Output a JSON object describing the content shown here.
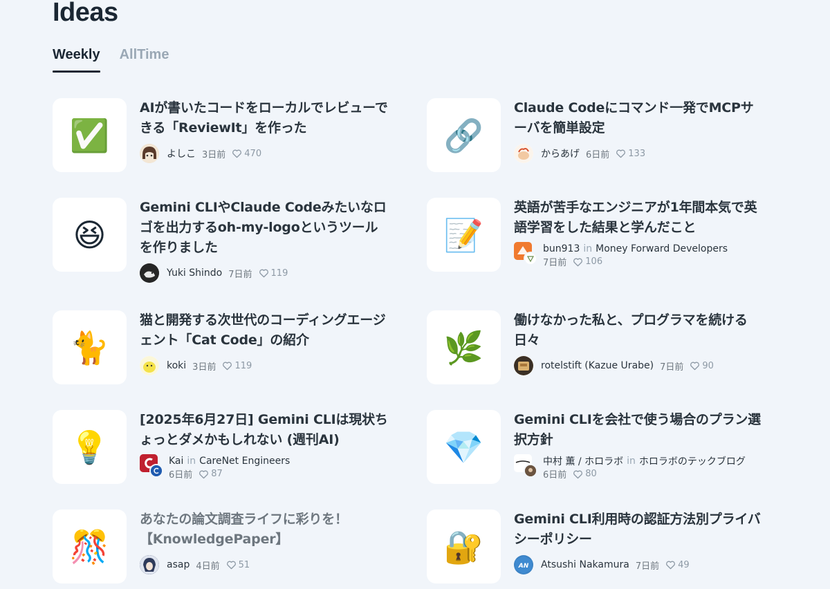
{
  "page": {
    "title": "Ideas"
  },
  "tabs": [
    {
      "label": "Weekly",
      "active": true
    },
    {
      "label": "AllTime",
      "active": false
    }
  ],
  "articles": [
    {
      "emoji": "✅",
      "emoji_name": "check-mark-icon",
      "title": "AIが書いたコードをローカルでレビューできる「ReviewIt」を作った",
      "author": "よしこ",
      "date": "3日前",
      "likes": "470"
    },
    {
      "emoji": "🔗",
      "emoji_name": "link-icon",
      "title": "Claude Codeにコマンド一発でMCPサーバを簡単設定",
      "author": "からあげ",
      "date": "6日前",
      "likes": "133"
    },
    {
      "emoji": "😆",
      "emoji_name": "laughing-face-icon",
      "title": "Gemini CLIやClaude Codeみたいなロゴを出力するoh-my-logoというツールを作りました",
      "author": "Yuki Shindo",
      "date": "7日前",
      "likes": "119"
    },
    {
      "emoji": "📝",
      "emoji_name": "memo-icon",
      "title": "英語が苦手なエンジニアが1年間本気で英語学習をした結果と学んだこと",
      "author": "bun913",
      "publication": "Money Forward Developers",
      "in_label": "in",
      "date": "7日前",
      "likes": "106"
    },
    {
      "emoji": "🐈",
      "emoji_name": "cat-icon",
      "title": "猫と開発する次世代のコーディングエージェント「Cat Code」の紹介",
      "author": "koki",
      "date": "3日前",
      "likes": "119"
    },
    {
      "emoji": "🌿",
      "emoji_name": "herb-icon",
      "title": "働けなかった私と、プログラマを続ける日々",
      "author": "rotelstift (Kazue Urabe)",
      "date": "7日前",
      "likes": "90"
    },
    {
      "emoji": "💡",
      "emoji_name": "light-bulb-icon",
      "title": "[2025年6月27日] Gemini CLIは現状ちょっとダメかもしれない (週刊AI)",
      "author": "Kai",
      "publication": "CareNet Engineers",
      "in_label": "in",
      "date": "6日前",
      "likes": "87"
    },
    {
      "emoji": "💎",
      "emoji_name": "gem-icon",
      "title": "Gemini CLIを会社で使う場合のプラン選択方針",
      "author": "中村 薫 / ホロラボ",
      "publication": "ホロラボのテックブログ",
      "in_label": "in",
      "date": "6日前",
      "likes": "80"
    },
    {
      "emoji": "🎊",
      "emoji_name": "confetti-ball-icon",
      "title": "あなたの論文調査ライフに彩りを！【KnowledgePaper】",
      "author": "asap",
      "date": "4日前",
      "likes": "51"
    },
    {
      "emoji": "🔐",
      "emoji_name": "lock-with-key-icon",
      "title": "Gemini CLI利用時の認証方法別プライバシーポリシー",
      "author": "Atsushi Nakamura",
      "date": "7日前",
      "likes": "49"
    }
  ],
  "colors": {
    "background": "#f1f5fa",
    "card": "#ffffff",
    "text": "#2a343d",
    "muted": "#9aa8b5"
  }
}
